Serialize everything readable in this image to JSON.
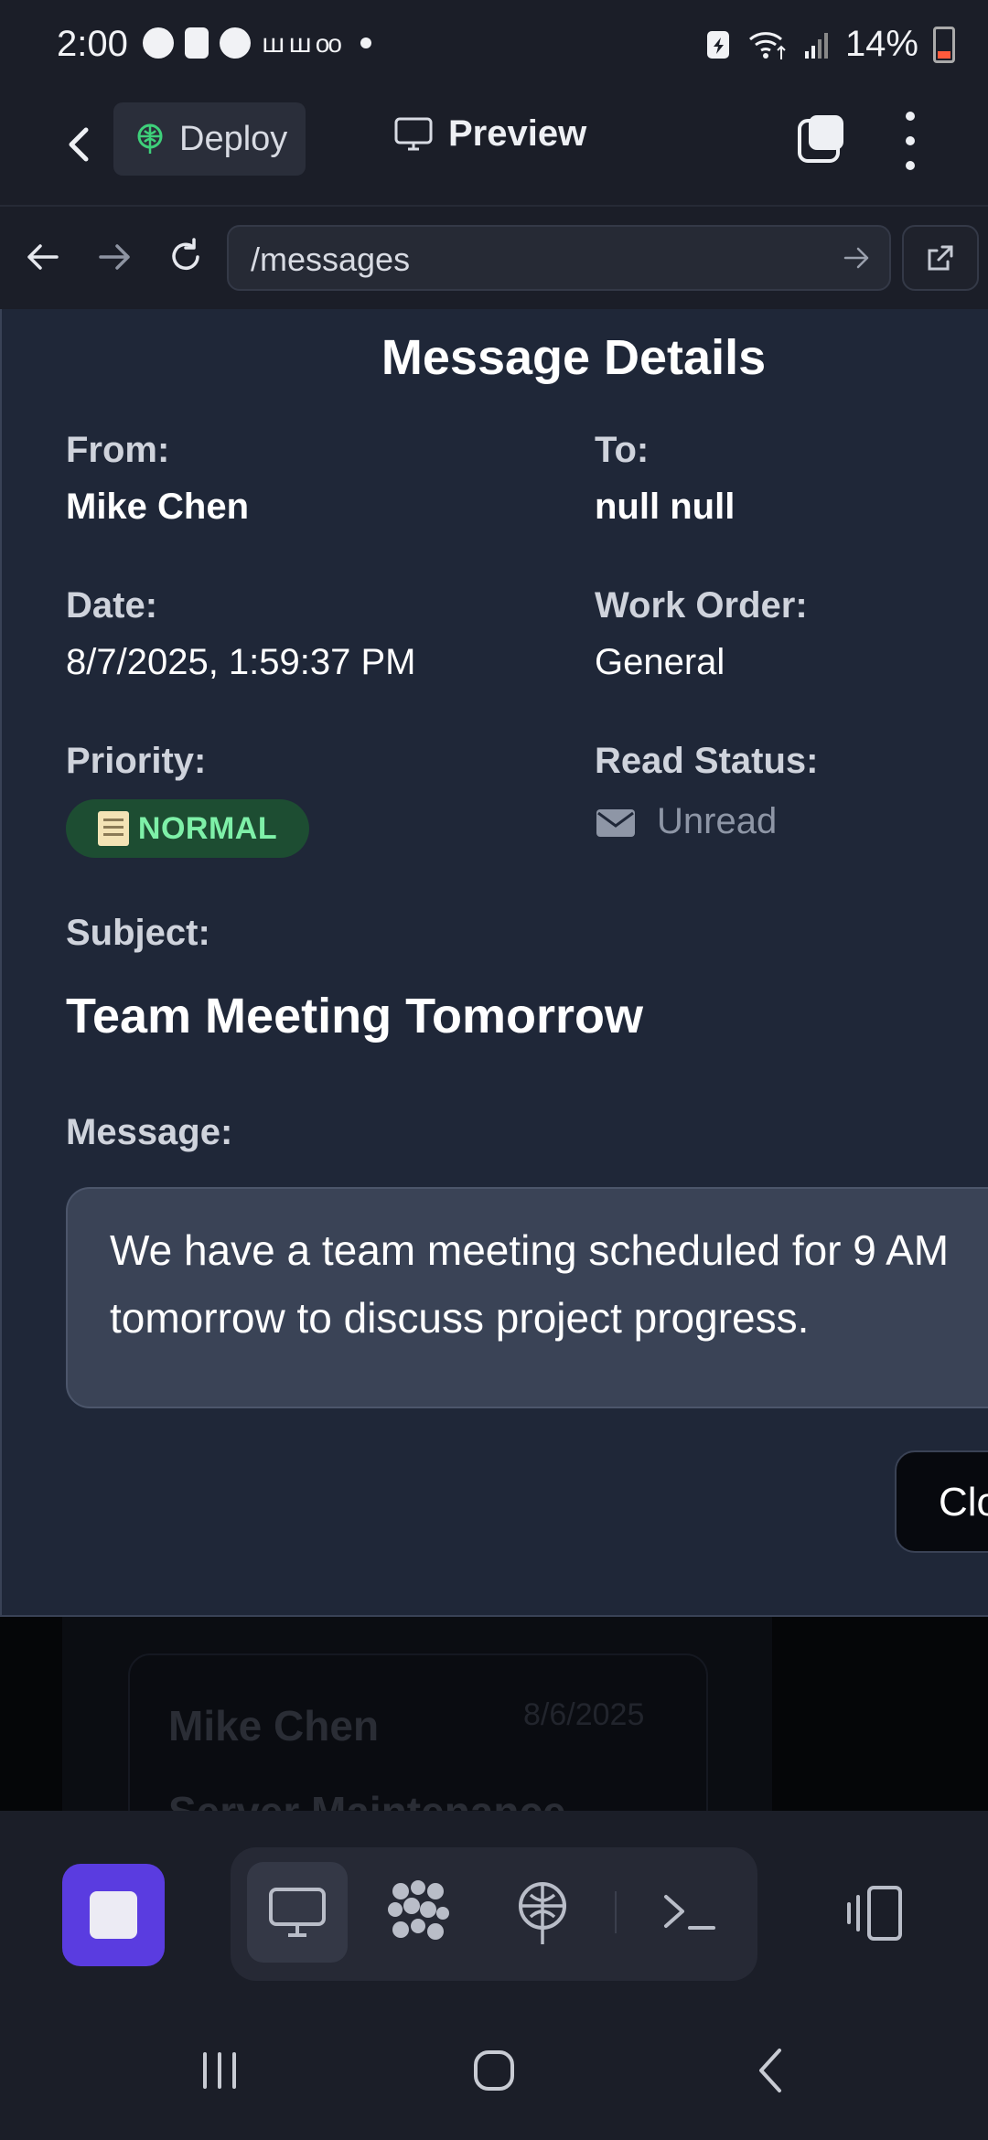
{
  "status_bar": {
    "time": "2:00",
    "notif_text": "ꟺ ꟺ ᴏᴏ",
    "battery": "14%"
  },
  "app_bar": {
    "deploy_label": "Deploy",
    "preview_label": "Preview"
  },
  "browser": {
    "url": "/messages"
  },
  "modal": {
    "title": "Message Details",
    "from_label": "From:",
    "from_value": "Mike Chen",
    "to_label": "To:",
    "to_value": "null null",
    "date_label": "Date:",
    "date_value": "8/7/2025, 1:59:37 PM",
    "work_order_label": "Work Order:",
    "work_order_value": "General",
    "priority_label": "Priority:",
    "priority_value": "NORMAL",
    "read_status_label": "Read Status:",
    "read_status_value": "Unread",
    "subject_label": "Subject:",
    "subject_value": "Team Meeting Tomorrow",
    "message_label": "Message:",
    "message_value": "We have a team meeting scheduled for 9 AM tomorrow to discuss project progress.",
    "close_label": "Close"
  },
  "background_list": {
    "name": "Mike Chen",
    "date": "8/6/2025",
    "subject": "Server Maintenance"
  },
  "colors": {
    "accent_purple": "#5a3ce0",
    "badge_green_bg": "#1d4d32",
    "badge_green_text": "#7ef0a8",
    "modal_bg": "#1f2738"
  },
  "icons": {
    "deploy": "deploy-globe-icon",
    "preview": "monitor-icon",
    "read_status": "envelope-icon"
  }
}
